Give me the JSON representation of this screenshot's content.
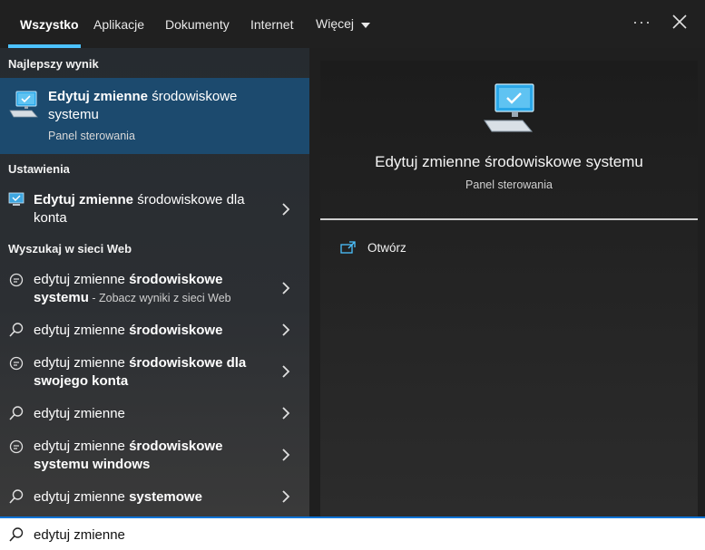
{
  "tabs": [
    {
      "label": "Wszystko",
      "active": true
    },
    {
      "label": "Aplikacje"
    },
    {
      "label": "Dokumenty"
    },
    {
      "label": "Internet"
    },
    {
      "label": "Więcej"
    }
  ],
  "topbar": {
    "more_icon": "ellipsis-icon",
    "close_icon": "close-icon"
  },
  "best_match": {
    "section_title": "Najlepszy wynik",
    "title_bold": "Edytuj zmienne",
    "title_rest": " środowiskowe systemu",
    "subtitle": "Panel sterowania",
    "icon": "computer-icon"
  },
  "settings": {
    "section_title": "Ustawienia",
    "item_bold": "Edytuj zmienne",
    "item_rest": " środowiskowe dla konta",
    "icon": "monitor-settings-icon"
  },
  "web": {
    "section_title": "Wyszukaj w sieci Web",
    "items": [
      {
        "icon": "chat-search-icon",
        "normal": "edytuj zmienne ",
        "bold": "środowiskowe systemu",
        "hint": " - Zobacz wyniki z sieci Web"
      },
      {
        "icon": "search-icon",
        "normal": "edytuj zmienne ",
        "bold": "środowiskowe",
        "hint": ""
      },
      {
        "icon": "chat-search-icon",
        "normal": "edytuj zmienne ",
        "bold": "środowiskowe dla swojego konta",
        "hint": ""
      },
      {
        "icon": "search-icon",
        "normal": "edytuj zmienne",
        "bold": "",
        "hint": ""
      },
      {
        "icon": "chat-search-icon",
        "normal": "edytuj zmienne ",
        "bold": "środowiskowe systemu windows",
        "hint": ""
      },
      {
        "icon": "search-icon",
        "normal": "edytuj zmienne ",
        "bold": "systemowe",
        "hint": ""
      }
    ]
  },
  "preview": {
    "title": "Edytuj zmienne środowiskowe systemu",
    "subtitle": "Panel sterowania",
    "action_label": "Otwórz",
    "action_icon": "open-icon"
  },
  "search": {
    "value": "edytuj zmienne",
    "icon": "search-icon"
  },
  "colors": {
    "accent": "#4cc2ff",
    "selected": "#1c4a6e",
    "search_border": "#0a74d8"
  }
}
